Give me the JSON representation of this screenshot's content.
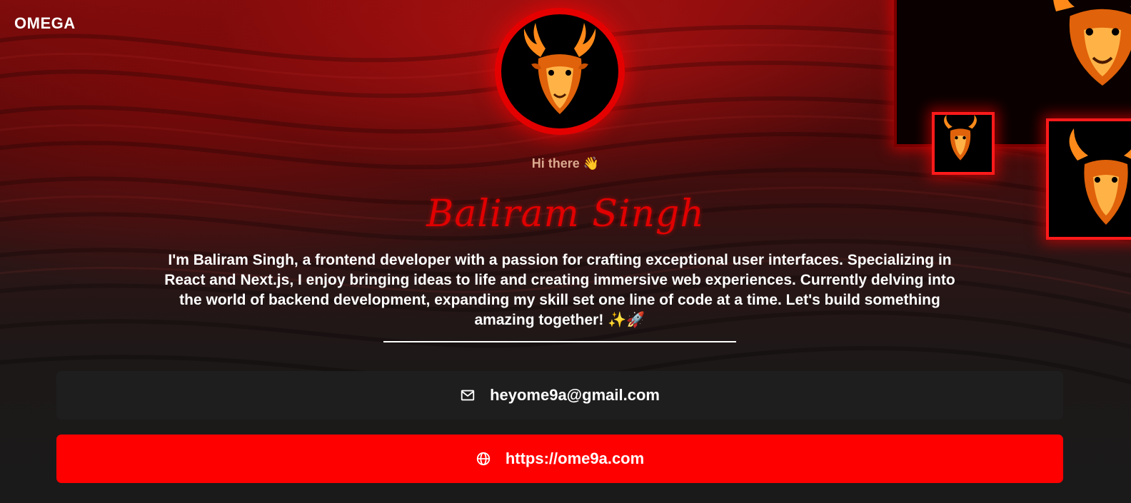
{
  "header": {
    "logo": "OMEGA"
  },
  "profile": {
    "avatar_icon": "deer-logo-icon",
    "greeting": "Hi there 👋",
    "name": "Baliram Singh",
    "bio": "I'm Baliram Singh, a frontend developer with a passion for crafting exceptional user interfaces. Specializing in React and Next.js, I enjoy bringing ideas to life and creating immersive web experiences. Currently delving into the world of backend development, expanding my skill set one line of code at a time. Let's build something amazing together! ✨🚀"
  },
  "links": {
    "email": {
      "icon": "mail-icon",
      "label": "heyome9a@gmail.com"
    },
    "website": {
      "icon": "globe-icon",
      "label": "https://ome9a.com"
    }
  },
  "colors": {
    "accent": "#ff0000",
    "background": "#1a1a1a",
    "card": "#1e1e1e",
    "greeting": "#d9a98f"
  }
}
